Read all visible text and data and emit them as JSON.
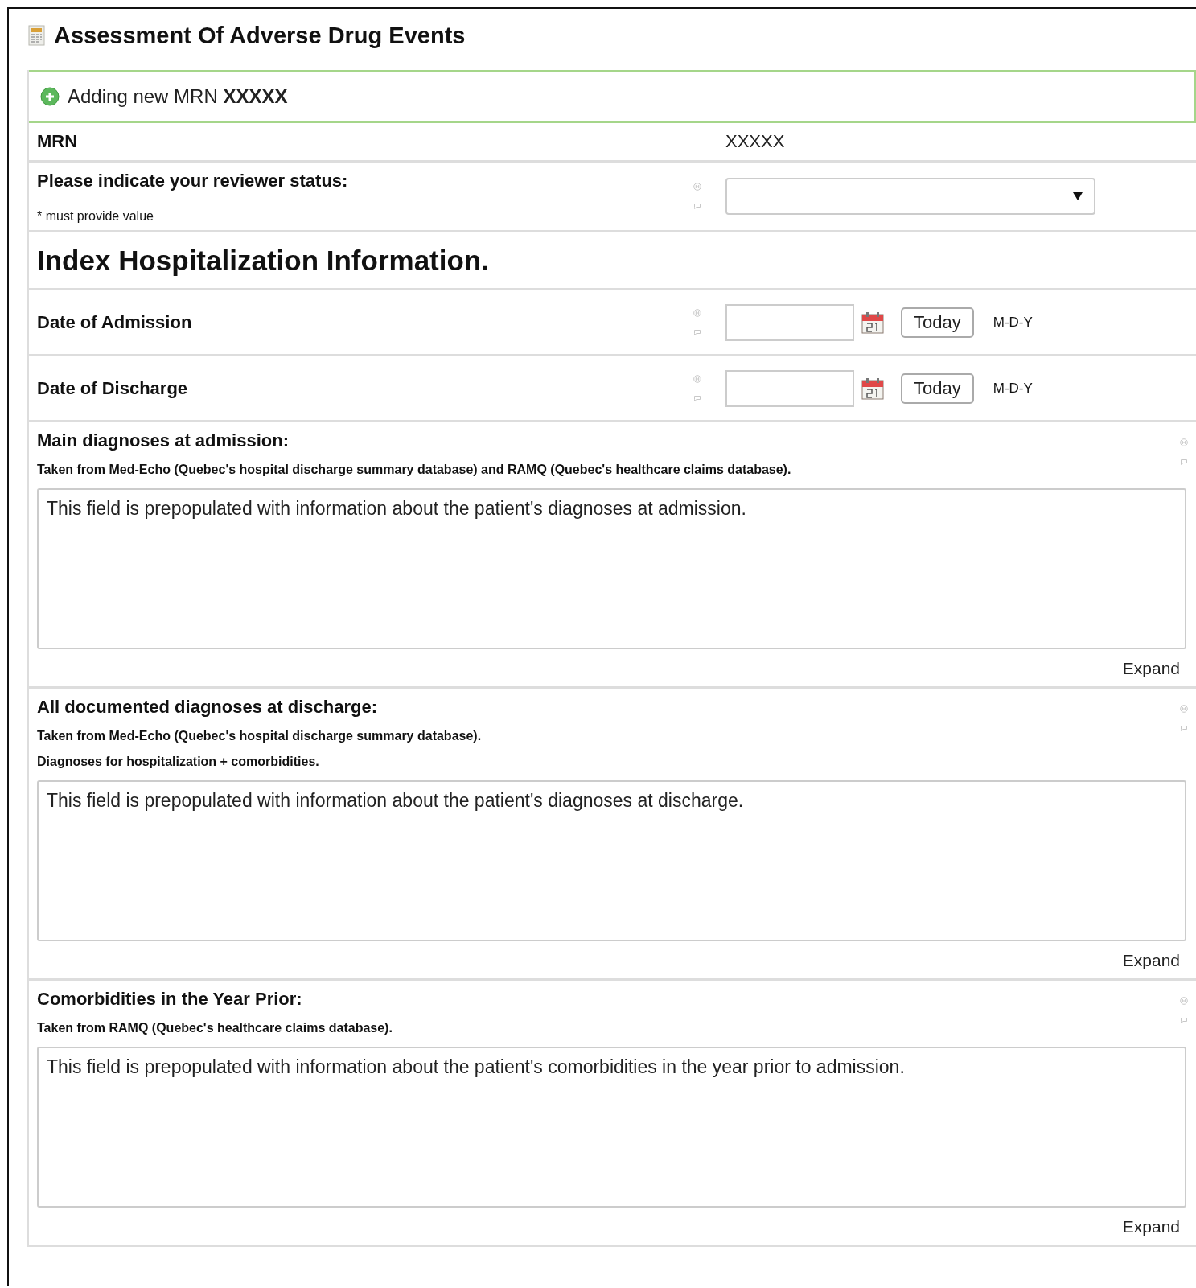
{
  "form": {
    "title": "Assessment Of Adverse Drug Events"
  },
  "banner": {
    "text": "Adding new MRN **XXXXX**"
  },
  "fields": [
    {
      "kind": "static",
      "label": "MRN",
      "value": "XXXXX"
    },
    {
      "kind": "dropdown",
      "label": "Please indicate your reviewer status:",
      "note": "* must provide value"
    },
    {
      "kind": "header",
      "label": "Index Hospitalization Information."
    },
    {
      "kind": "date",
      "label": "Date of Admission",
      "button": "Today",
      "format": "M-D-Y"
    },
    {
      "kind": "date",
      "label": "Date of Discharge",
      "button": "Today",
      "format": "M-D-Y"
    },
    {
      "kind": "textarea",
      "label": "Main diagnoses at admission:",
      "notes": [
        "Taken from Med-Echo (Quebec's hospital discharge summary database) and RAMQ (Quebec's healthcare claims database)."
      ],
      "value": "This field is prepopulated with information about the patient's diagnoses at admission.",
      "expand": "Expand"
    },
    {
      "kind": "textarea",
      "label": "All documented diagnoses at discharge:",
      "notes": [
        "Taken from Med-Echo (Quebec's hospital discharge summary database).",
        "Diagnoses for hospitalization + comorbidities."
      ],
      "value": "This field is prepopulated with information about the patient's diagnoses at discharge.",
      "expand": "Expand"
    },
    {
      "kind": "textarea",
      "label": "Comorbidities in the Year Prior:",
      "notes": [
        "Taken from RAMQ (Quebec's healthcare claims database)."
      ],
      "value": "This field is prepopulated with information about the patient's comorbidities in the year prior to admission.",
      "expand": "Expand"
    }
  ]
}
